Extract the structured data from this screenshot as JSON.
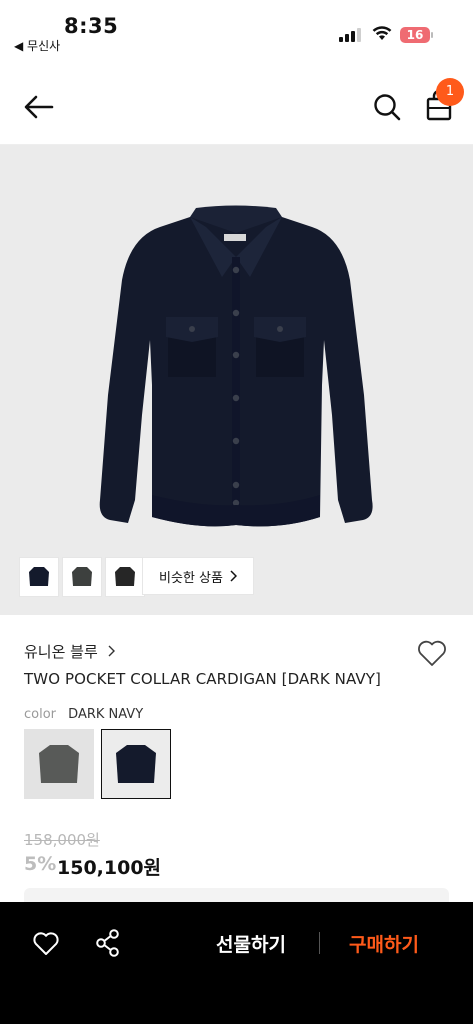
{
  "status_bar": {
    "time": "8:35",
    "back_app": "◀ 무신사",
    "battery": "16"
  },
  "nav": {
    "cart_count": "1"
  },
  "gallery": {
    "similar_label": "비슷한 상품"
  },
  "product": {
    "brand": "유니온 블루",
    "title": "TWO POCKET COLLAR CARDIGAN [DARK NAVY]",
    "color_label": "color",
    "color_value": "DARK NAVY",
    "original_price": "158,000원",
    "discount": "5%",
    "sale_price": "150,100원"
  },
  "bottom_bar": {
    "gift_label": "선물하기",
    "buy_label": "구매하기"
  },
  "colors": {
    "accent": "#ff5a1a",
    "navy": "#141a2c",
    "hero_bg": "#ebebeb"
  }
}
